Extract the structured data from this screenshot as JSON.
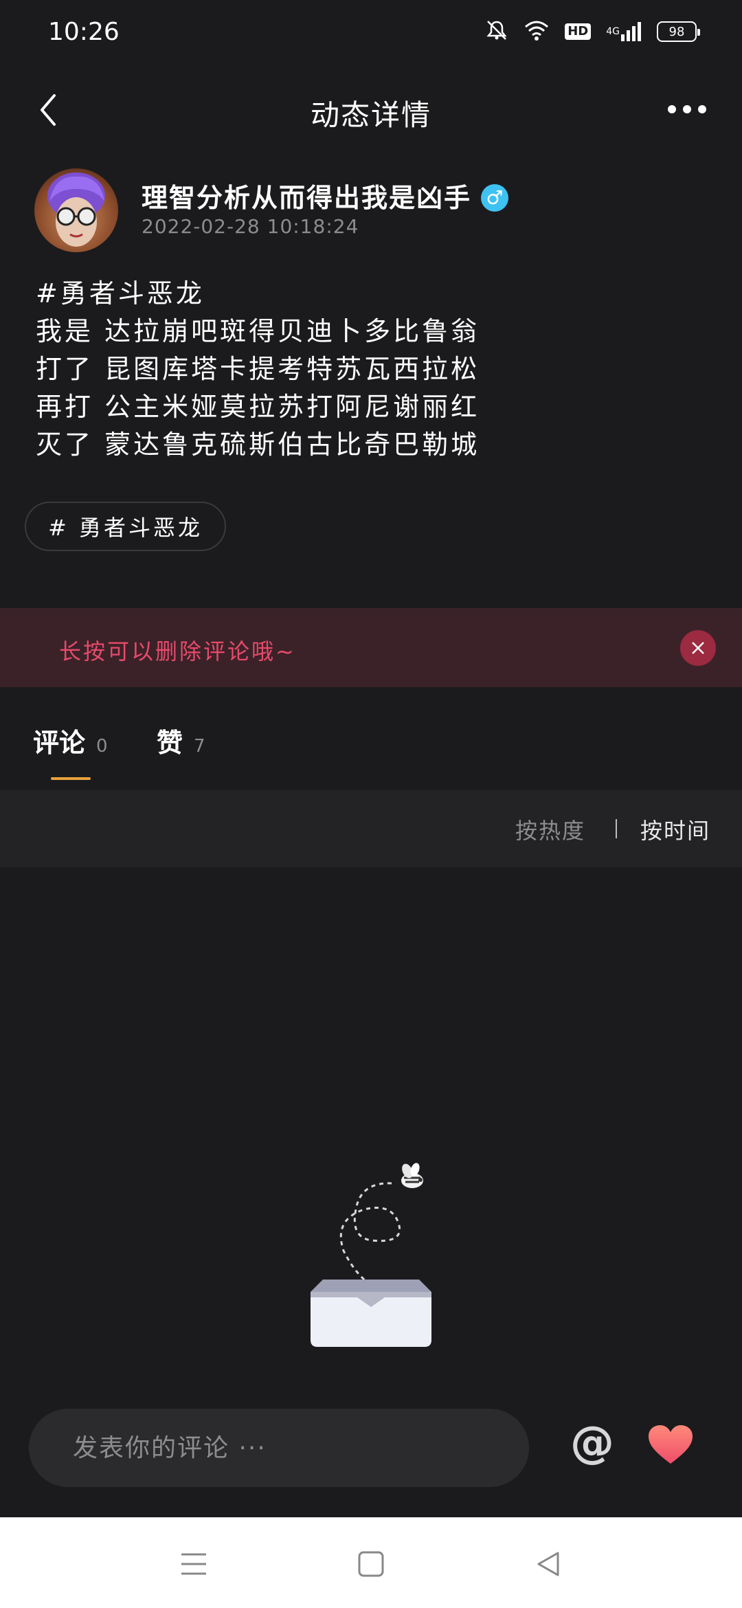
{
  "status_bar": {
    "time": "10:26",
    "hd": "HD",
    "network": "4G",
    "battery": "98"
  },
  "header": {
    "title": "动态详情"
  },
  "author": {
    "name": "理智分析从而得出我是凶手",
    "gender_symbol": "♂",
    "post_time": "2022-02-28 10:18:24"
  },
  "post": {
    "lines": [
      "#勇者斗恶龙",
      "我是 达拉崩吧斑得贝迪卜多比鲁翁",
      "打了 昆图库塔卡提考特苏瓦西拉松",
      "再打 公主米娅莫拉苏打阿尼谢丽红",
      "灭了 蒙达鲁克硫斯伯古比奇巴勒城"
    ],
    "topic_chip": "# 勇者斗恶龙"
  },
  "hint": {
    "text": "长按可以删除评论哦~"
  },
  "tabs": [
    {
      "label": "评论",
      "count": "0"
    },
    {
      "label": "赞",
      "count": "7"
    }
  ],
  "sort": {
    "hot": "按热度",
    "time": "按时间"
  },
  "comment_bar": {
    "placeholder": "发表你的评论 ···",
    "at_symbol": "@"
  },
  "colors": {
    "background": "#1b1b1d",
    "accent_underline": "#e8a23d",
    "hint_text": "#e84a6b",
    "gender_badge": "#3ec2f2",
    "heart": "#f0646c"
  }
}
